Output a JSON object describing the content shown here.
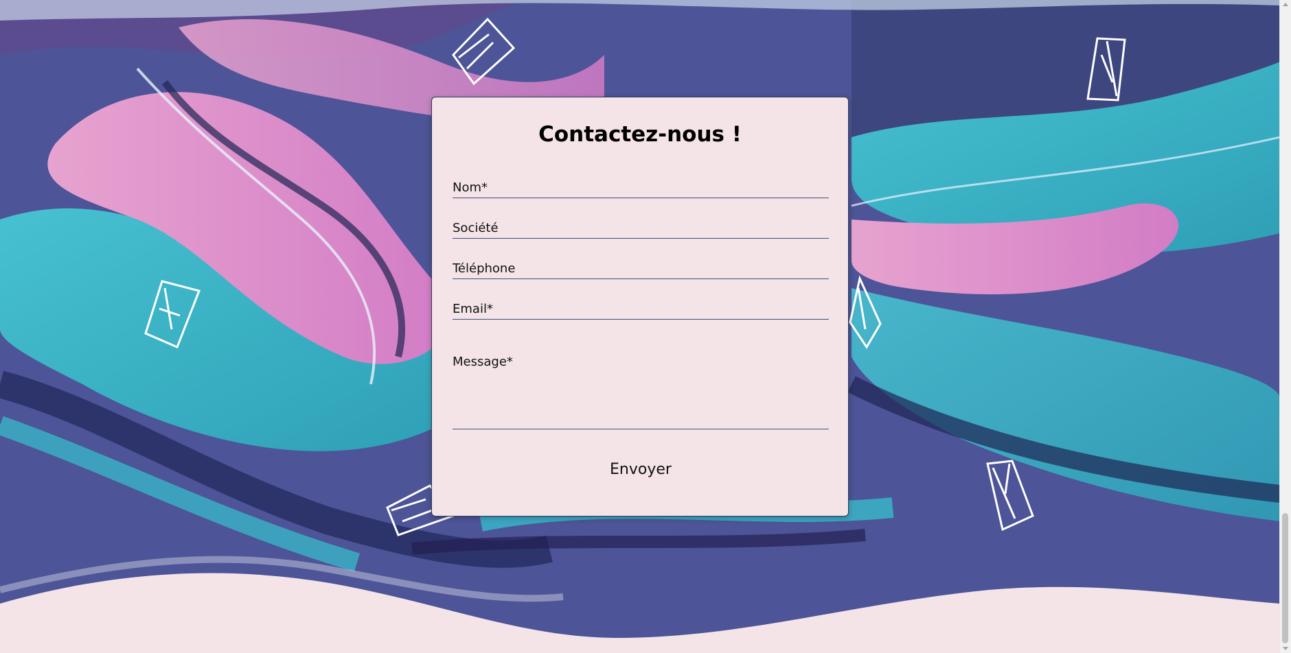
{
  "form": {
    "title": "Contactez-nous !",
    "fields": {
      "name_placeholder": "Nom*",
      "company_placeholder": "Société",
      "phone_placeholder": "Téléphone",
      "email_placeholder": "Email*",
      "message_placeholder": "Message*"
    },
    "submit_label": "Envoyer"
  },
  "theme": {
    "page_background": "#f4e4e7",
    "card_background": "#f4e4e7",
    "field_underline": "#3c4f73",
    "marble_colors": [
      "#3fb3c8",
      "#e08ccf",
      "#4b4f93",
      "#2a2f63",
      "#a9c4e6"
    ]
  },
  "decorations": {
    "icon": "envelope-icon"
  }
}
